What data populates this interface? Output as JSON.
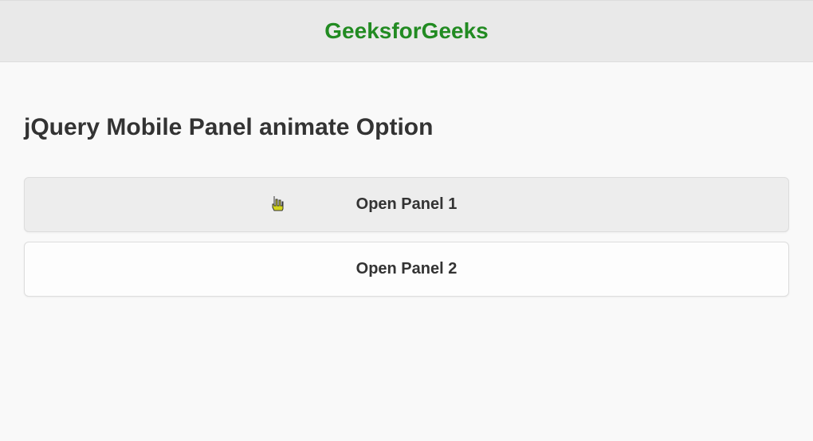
{
  "header": {
    "title": "GeeksforGeeks"
  },
  "main": {
    "heading": "jQuery Mobile Panel animate Option",
    "buttons": [
      {
        "label": "Open Panel 1"
      },
      {
        "label": "Open Panel 2"
      }
    ]
  }
}
